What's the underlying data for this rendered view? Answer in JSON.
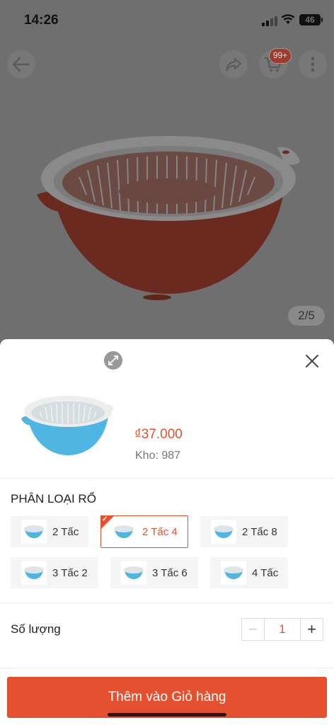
{
  "status": {
    "time": "14:26",
    "battery": "46"
  },
  "header": {
    "back_icon": "arrow-left-icon",
    "share_icon": "share-icon",
    "cart_icon": "cart-icon",
    "cart_badge": "99+",
    "more_icon": "more-vertical-icon"
  },
  "gallery": {
    "counter": "2/5"
  },
  "sheet": {
    "price": "₫37.000",
    "stock": "Kho: 987",
    "variant_label": "PHÂN LOẠI RỔ",
    "options": [
      {
        "label": "2 Tấc"
      },
      {
        "label": "2 Tấc 4"
      },
      {
        "label": "2 Tấc 8"
      },
      {
        "label": "3 Tấc 2"
      },
      {
        "label": "3 Tấc 6"
      },
      {
        "label": "4 Tấc"
      }
    ],
    "selected_option": "2 Tấc 4",
    "quantity_label": "Số lượng",
    "quantity": "1",
    "add_button": "Thêm vào Giỏ hàng"
  },
  "colors": {
    "accent": "#e5512e",
    "bowl_red": "#d8432a",
    "bowl_blue": "#4fb6e3"
  }
}
